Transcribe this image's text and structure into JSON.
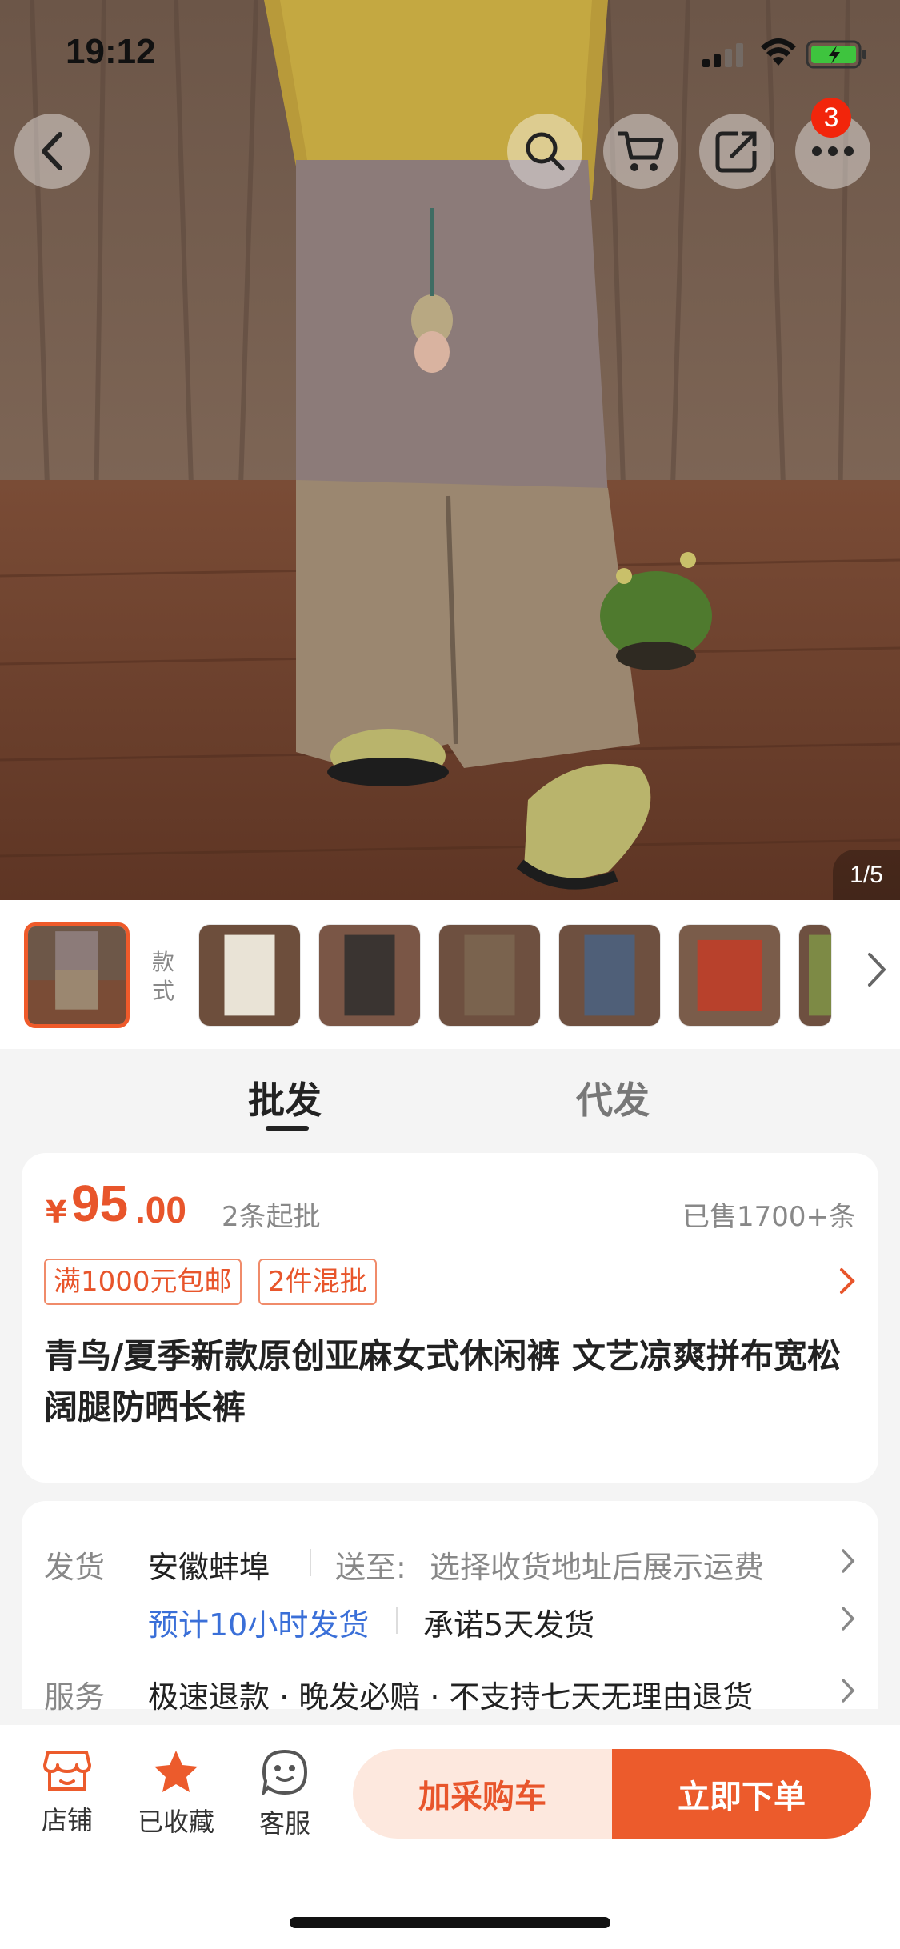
{
  "status_bar": {
    "time": "19:12"
  },
  "nav": {
    "cart_badge": "3"
  },
  "gallery": {
    "counter": "1/5"
  },
  "style_strip": {
    "label": "款\n式",
    "thumb_colors": [
      "#c9bfb3",
      "#e9e3d6",
      "#3a3431",
      "#7a634e",
      "#4f5f78",
      "#b8412c",
      "#7d8a45"
    ]
  },
  "tabs": [
    {
      "label": "批发",
      "active": true
    },
    {
      "label": "代发",
      "active": false
    }
  ],
  "price": {
    "currency": "¥",
    "integer": "95",
    "decimal": ".00",
    "min_qty": "2条起批",
    "sold": "已售1700+条",
    "tags": [
      "满1000元包邮",
      "2件混批"
    ]
  },
  "product": {
    "title": "青鸟/夏季新款原创亚麻女式休闲裤 文艺凉爽拼布宽松阔腿防晒长裤"
  },
  "shipping": {
    "label": "发货",
    "origin": "安徽蚌埠",
    "to_label": "送至:",
    "to_value": "选择收货地址后展示运费",
    "eta": "预计10小时发货",
    "promise": "承诺5天发货"
  },
  "service": {
    "label": "服务",
    "value": "极速退款 · 晚发必赔 · 不支持七天无理由退货"
  },
  "bottom_bar": {
    "store": "店铺",
    "favorited": "已收藏",
    "support": "客服",
    "add_cart": "加采购车",
    "buy_now": "立即下单"
  },
  "colors": {
    "accent": "#ec5b2c",
    "link_blue": "#3a6fd8"
  }
}
